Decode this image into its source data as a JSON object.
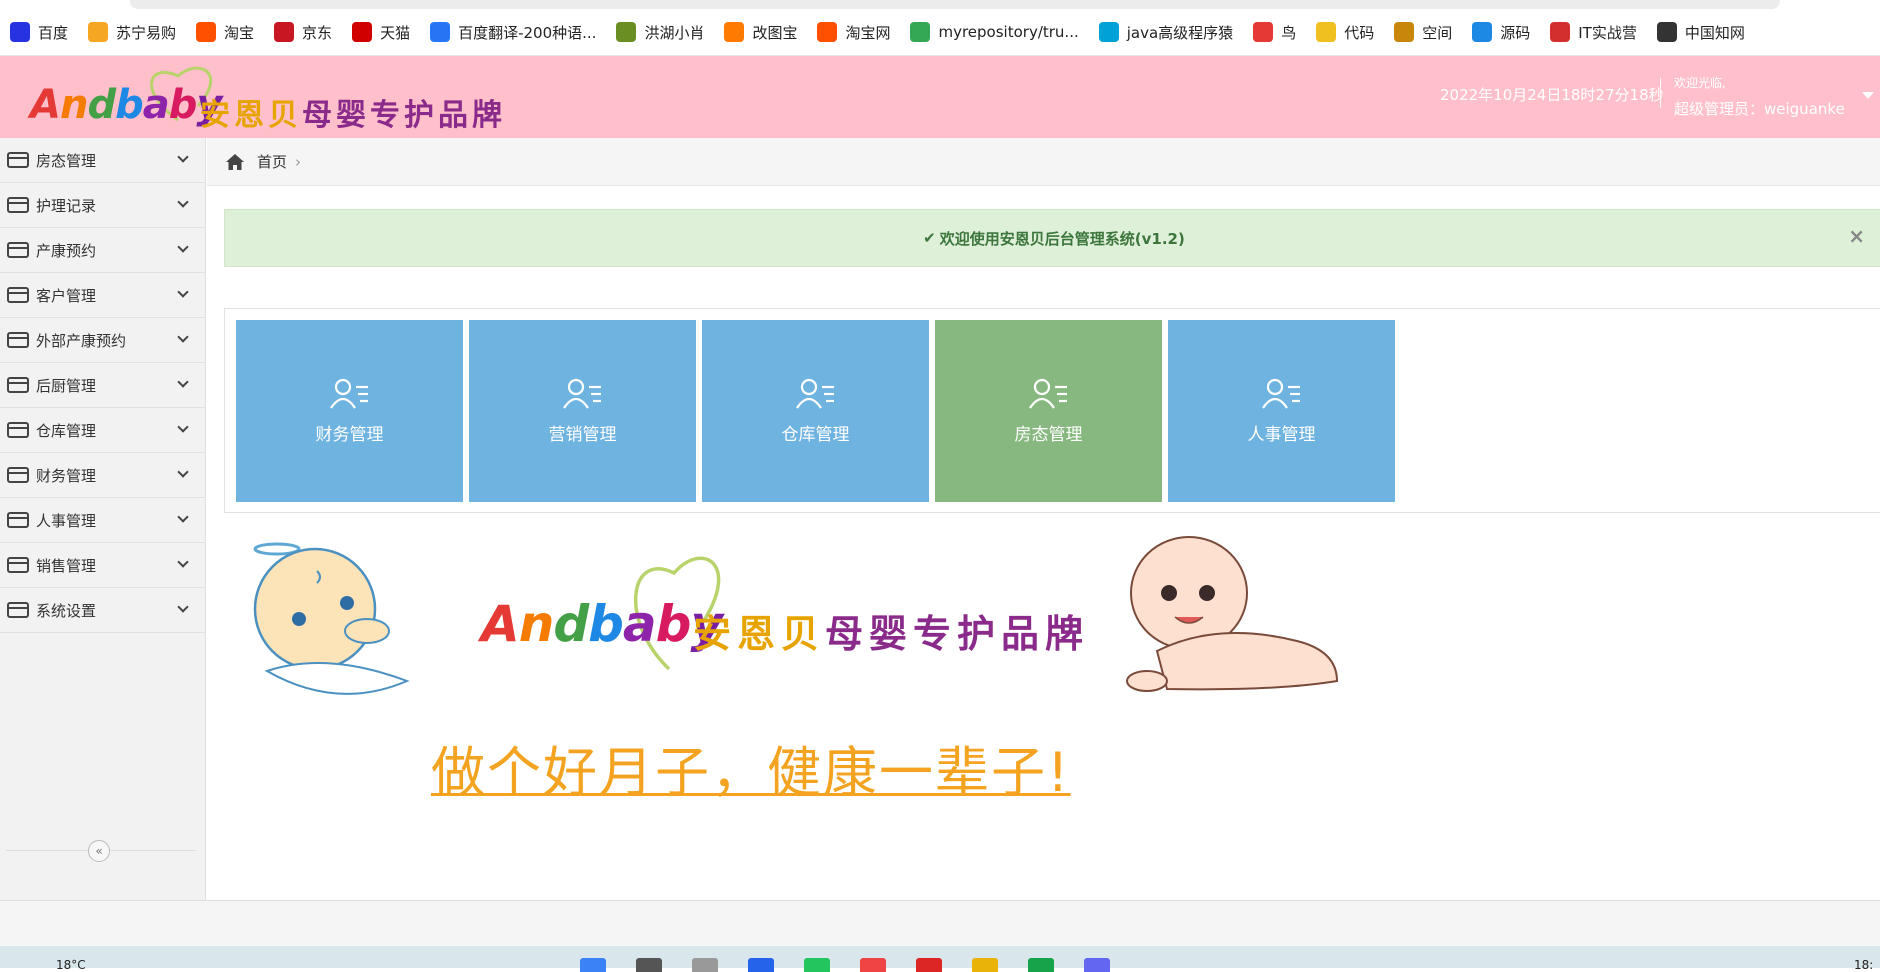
{
  "bookmarks": [
    {
      "label": "百度",
      "icon": "paw-icon",
      "color": "#2932e1"
    },
    {
      "label": "苏宁易购",
      "icon": "lion-icon",
      "color": "#f5a623"
    },
    {
      "label": "淘宝",
      "icon": "taobao-icon",
      "color": "#ff5000"
    },
    {
      "label": "京东",
      "icon": "jd-icon",
      "color": "#c91623"
    },
    {
      "label": "天猫",
      "icon": "tmall-icon",
      "color": "#d10000"
    },
    {
      "label": "百度翻译-200种语...",
      "icon": "translate-icon",
      "color": "#2575f5"
    },
    {
      "label": "洪湖小肖",
      "icon": "feather-icon",
      "color": "#6b8e23"
    },
    {
      "label": "改图宝",
      "icon": "image-edit-icon",
      "color": "#ff7a00"
    },
    {
      "label": "淘宝网",
      "icon": "taobao-icon",
      "color": "#ff5000"
    },
    {
      "label": "myrepository/tru...",
      "icon": "chrome-icon",
      "color": "#34a853"
    },
    {
      "label": "java高级程序猿",
      "icon": "bilibili-icon",
      "color": "#00a1d6"
    },
    {
      "label": "鸟",
      "icon": "bird-icon",
      "color": "#e53935"
    },
    {
      "label": "代码",
      "icon": "code-icon",
      "color": "#f0c020"
    },
    {
      "label": "空间",
      "icon": "space-icon",
      "color": "#c8860b"
    },
    {
      "label": "源码",
      "icon": "fish-icon",
      "color": "#1e88e5"
    },
    {
      "label": "IT实战营",
      "icon": "it-icon",
      "color": "#d32f2f"
    },
    {
      "label": "中国知网",
      "icon": "cnki-icon",
      "color": "#333333"
    }
  ],
  "header": {
    "logo_text": "Andbaby",
    "logo_cn_a": "安恩贝",
    "logo_cn_b": "母婴专护品牌",
    "datetime": "2022年10月24日18时27分18秒",
    "welcome": "欢迎光临,",
    "user": "超级管理员：weiguanke",
    "bg_color": "#ffc0cb"
  },
  "sidebar": {
    "items": [
      {
        "label": "房态管理"
      },
      {
        "label": "护理记录"
      },
      {
        "label": "产康预约"
      },
      {
        "label": "客户管理"
      },
      {
        "label": "外部产康预约"
      },
      {
        "label": "后厨管理"
      },
      {
        "label": "仓库管理"
      },
      {
        "label": "财务管理"
      },
      {
        "label": "人事管理"
      },
      {
        "label": "销售管理"
      },
      {
        "label": "系统设置"
      }
    ],
    "collapse_icon": "«"
  },
  "breadcrumb": {
    "home_label": "首页",
    "separator": "›"
  },
  "alert": {
    "check": "✔",
    "message": "欢迎使用安恩贝后台管理系统(v1.2)",
    "close": "×"
  },
  "tiles": [
    {
      "label": "财务管理",
      "color": "#6fb3e0"
    },
    {
      "label": "营销管理",
      "color": "#6fb3e0"
    },
    {
      "label": "仓库管理",
      "color": "#6fb3e0"
    },
    {
      "label": "房态管理",
      "color": "#87b87f"
    },
    {
      "label": "人事管理",
      "color": "#6fb3e0"
    }
  ],
  "banner": {
    "logo_text": "Andbaby",
    "logo_cn_a": "安恩贝",
    "logo_cn_b": "母婴专护品牌"
  },
  "slogan": "做个好月子，健康一辈子!",
  "taskbar": {
    "weather": "18°C",
    "clock": "18:"
  }
}
